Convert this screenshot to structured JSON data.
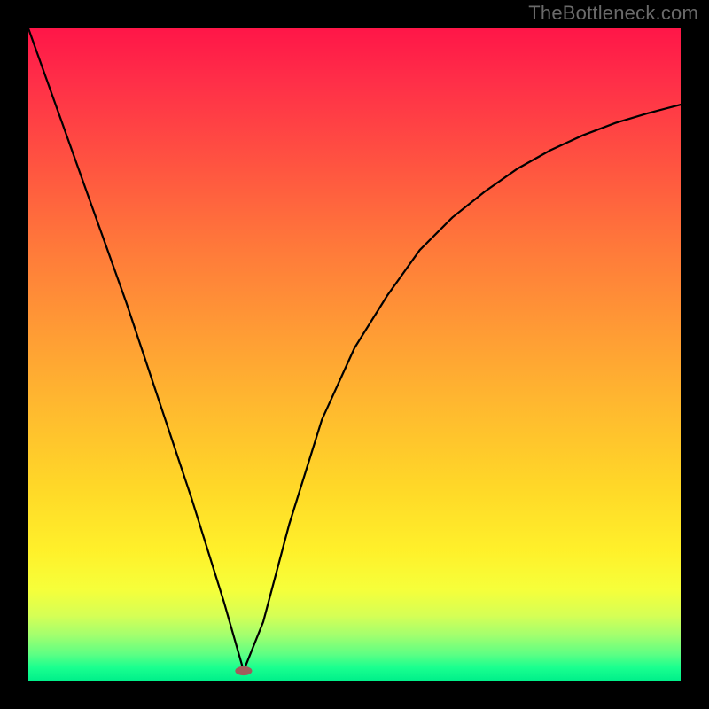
{
  "watermark": "TheBottleneck.com",
  "chart_data": {
    "type": "line",
    "title": "",
    "xlabel": "",
    "ylabel": "",
    "xlim": [
      0,
      100
    ],
    "ylim": [
      0,
      100
    ],
    "series": [
      {
        "name": "left-branch",
        "x": [
          0,
          5,
          10,
          15,
          20,
          25,
          30,
          33
        ],
        "values": [
          100,
          86,
          72,
          58,
          43,
          28,
          12,
          1.5
        ]
      },
      {
        "name": "right-branch",
        "x": [
          33,
          36,
          40,
          45,
          50,
          55,
          60,
          65,
          70,
          75,
          80,
          85,
          90,
          95,
          100
        ],
        "values": [
          1.5,
          9,
          24,
          40,
          51,
          59,
          66,
          71,
          75,
          78.5,
          81.3,
          83.6,
          85.5,
          87,
          88.3
        ]
      }
    ],
    "marker": {
      "x": 33,
      "y": 1.5,
      "rx": 1.3,
      "ry": 0.7,
      "color": "#a15c5c"
    },
    "gradient_stops": [
      {
        "pct": 0,
        "color": "#ff1648"
      },
      {
        "pct": 50,
        "color": "#ffc22c"
      },
      {
        "pct": 85,
        "color": "#fff030"
      },
      {
        "pct": 100,
        "color": "#00f08a"
      }
    ]
  }
}
